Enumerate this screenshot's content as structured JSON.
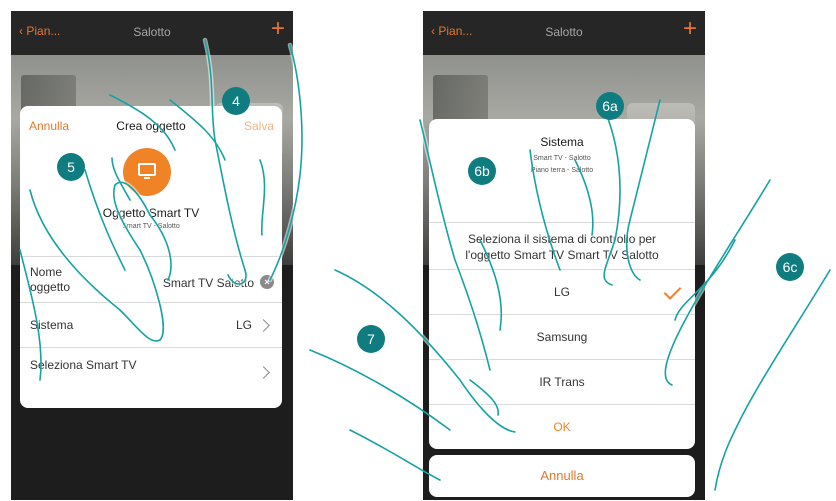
{
  "left": {
    "nav": {
      "back": "Pian...",
      "title": "Salotto",
      "add": "+"
    },
    "dialog": {
      "cancel": "Annulla",
      "title": "Crea oggetto",
      "save": "Salva",
      "icon": "tv-icon",
      "object_name": "Oggetto Smart TV",
      "object_sub": "Smart TV - Salotto",
      "rows": [
        {
          "label": "Nome oggetto",
          "value": "Smart TV Salotto"
        },
        {
          "label": "Sistema",
          "value": "LG"
        },
        {
          "label": "Seleziona Smart TV",
          "value": ""
        }
      ]
    }
  },
  "right": {
    "nav": {
      "back": "Pian...",
      "title": "Salotto",
      "add": "+"
    },
    "sheet": {
      "title": "Sistema",
      "sub1": "Smart TV - Salotto",
      "sub2": "Piano terra - Salotto",
      "prompt": "Seleziona il sistema di controllo per l'oggetto Smart TV Smart TV Salotto",
      "options": [
        "LG",
        "Samsung",
        "IR Trans"
      ],
      "selected": "LG",
      "ok": "OK"
    },
    "cancel": "Annulla"
  },
  "markers": [
    "4",
    "5",
    "6a",
    "6b",
    "6c",
    "7"
  ],
  "colors": {
    "accent": "#f18327",
    "marker": "#0f7d80",
    "hand_outline": "#17a2a2"
  }
}
